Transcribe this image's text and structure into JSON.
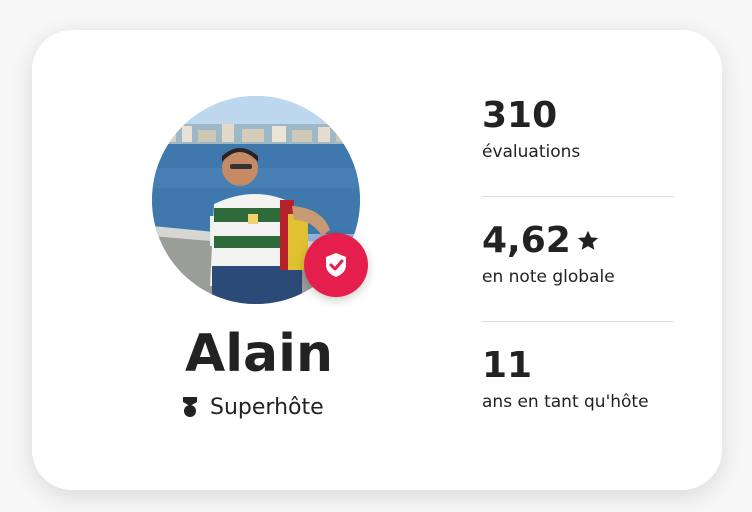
{
  "profile": {
    "name": "Alain",
    "badge_label": "Superhôte",
    "badge_icon": "superhost-medal-icon",
    "verified_icon": "verified-shield-icon",
    "accent_color": "#e61e4d"
  },
  "stats": [
    {
      "value": "310",
      "label": "évaluations"
    },
    {
      "value": "4,62",
      "label": "en note globale",
      "icon": "star-icon"
    },
    {
      "value": "11",
      "label": "ans en tant qu'hôte"
    }
  ]
}
